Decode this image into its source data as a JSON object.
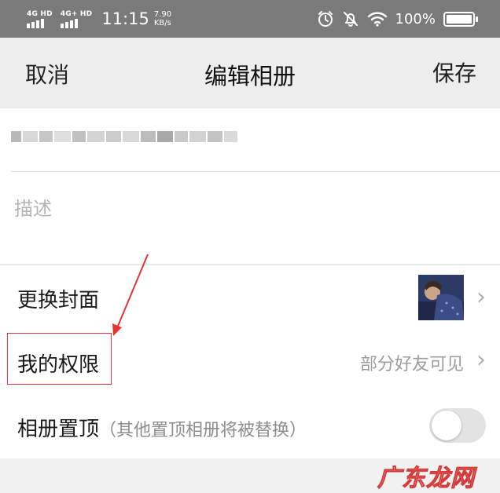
{
  "status_bar": {
    "sim1_label": "4G HD",
    "sim2_label": "4G+ HD",
    "time": "11:15",
    "net_speed_value": "7.90",
    "net_speed_unit": "KB/s",
    "icons": [
      "alarm-icon",
      "mute-bell-icon",
      "wifi-icon"
    ],
    "battery_percent": "100%",
    "battery_level": 1.0
  },
  "nav": {
    "cancel_label": "取消",
    "title": "编辑相册",
    "save_label": "保存"
  },
  "form": {
    "description_placeholder": "描述"
  },
  "rows": {
    "cover_label": "更换封面",
    "permission_label": "我的权限",
    "permission_value": "部分好友可见",
    "pin_label": "相册置顶",
    "pin_note": "（其他置顶相册将被替换）",
    "pin_enabled": false
  },
  "annotation": {
    "color": "#e53333"
  },
  "watermark": {
    "text": "广东龙网"
  },
  "colors": {
    "status_bar_bg": "#7a7a7a",
    "nav_bg": "#ededed",
    "placeholder": "#b5b5b5",
    "secondary_text": "#9c9c9c"
  }
}
